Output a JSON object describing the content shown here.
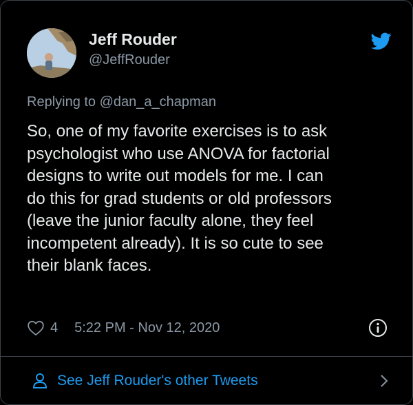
{
  "tweet": {
    "author_name": "Jeff Rouder",
    "author_handle": "@JeffRouder",
    "replying_prefix": "Replying to",
    "replying_to": "@dan_a_chapman",
    "text": "So, one of my favorite exercises is to ask\npsychologist who use ANOVA for factorial\ndesigns to write out models for me.  I can\ndo this for grad students or old professors\n(leave the junior faculty alone, they feel\nincompetent already).  It is so cute to see\ntheir blank faces.",
    "like_count": "4",
    "timestamp": "5:22 PM - Nov 12, 2020"
  },
  "footer": {
    "see_more_label": "See Jeff Rouder's other Tweets"
  },
  "icons": {
    "brand": "twitter-bird-icon",
    "like": "heart-icon",
    "info": "info-icon",
    "profile": "person-icon",
    "chevron": "chevron-right-icon"
  },
  "colors": {
    "background": "#000000",
    "text": "#e7e9ea",
    "muted": "#8b98a5",
    "link": "#1d9bf0",
    "border": "#3d4349"
  }
}
